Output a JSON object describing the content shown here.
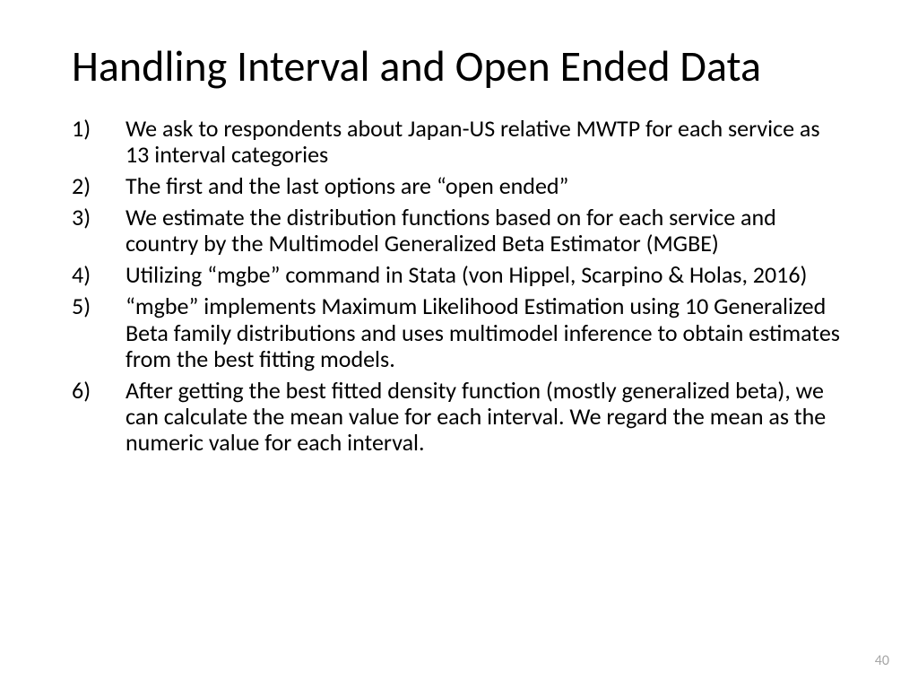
{
  "slide": {
    "title": "Handling Interval and Open Ended Data",
    "points": [
      "We ask to respondents about Japan-US relative MWTP for each service as 13 interval categories",
      "The first and the last options are “open ended”",
      "We estimate the distribution functions based on  for each service and country by the Multimodel Generalized Beta Estimator (MGBE)",
      "Utilizing “mgbe” command in Stata (von Hippel, Scarpino & Holas, 2016)",
      "“mgbe” implements Maximum Likelihood Estimation using 10 Generalized Beta family distributions and uses multimodel inference to obtain estimates from the best fitting models.",
      "After getting the best fitted density function (mostly generalized beta), we can calculate the mean value for each interval. We regard the mean as the numeric value for each interval."
    ],
    "page_number": "40"
  }
}
